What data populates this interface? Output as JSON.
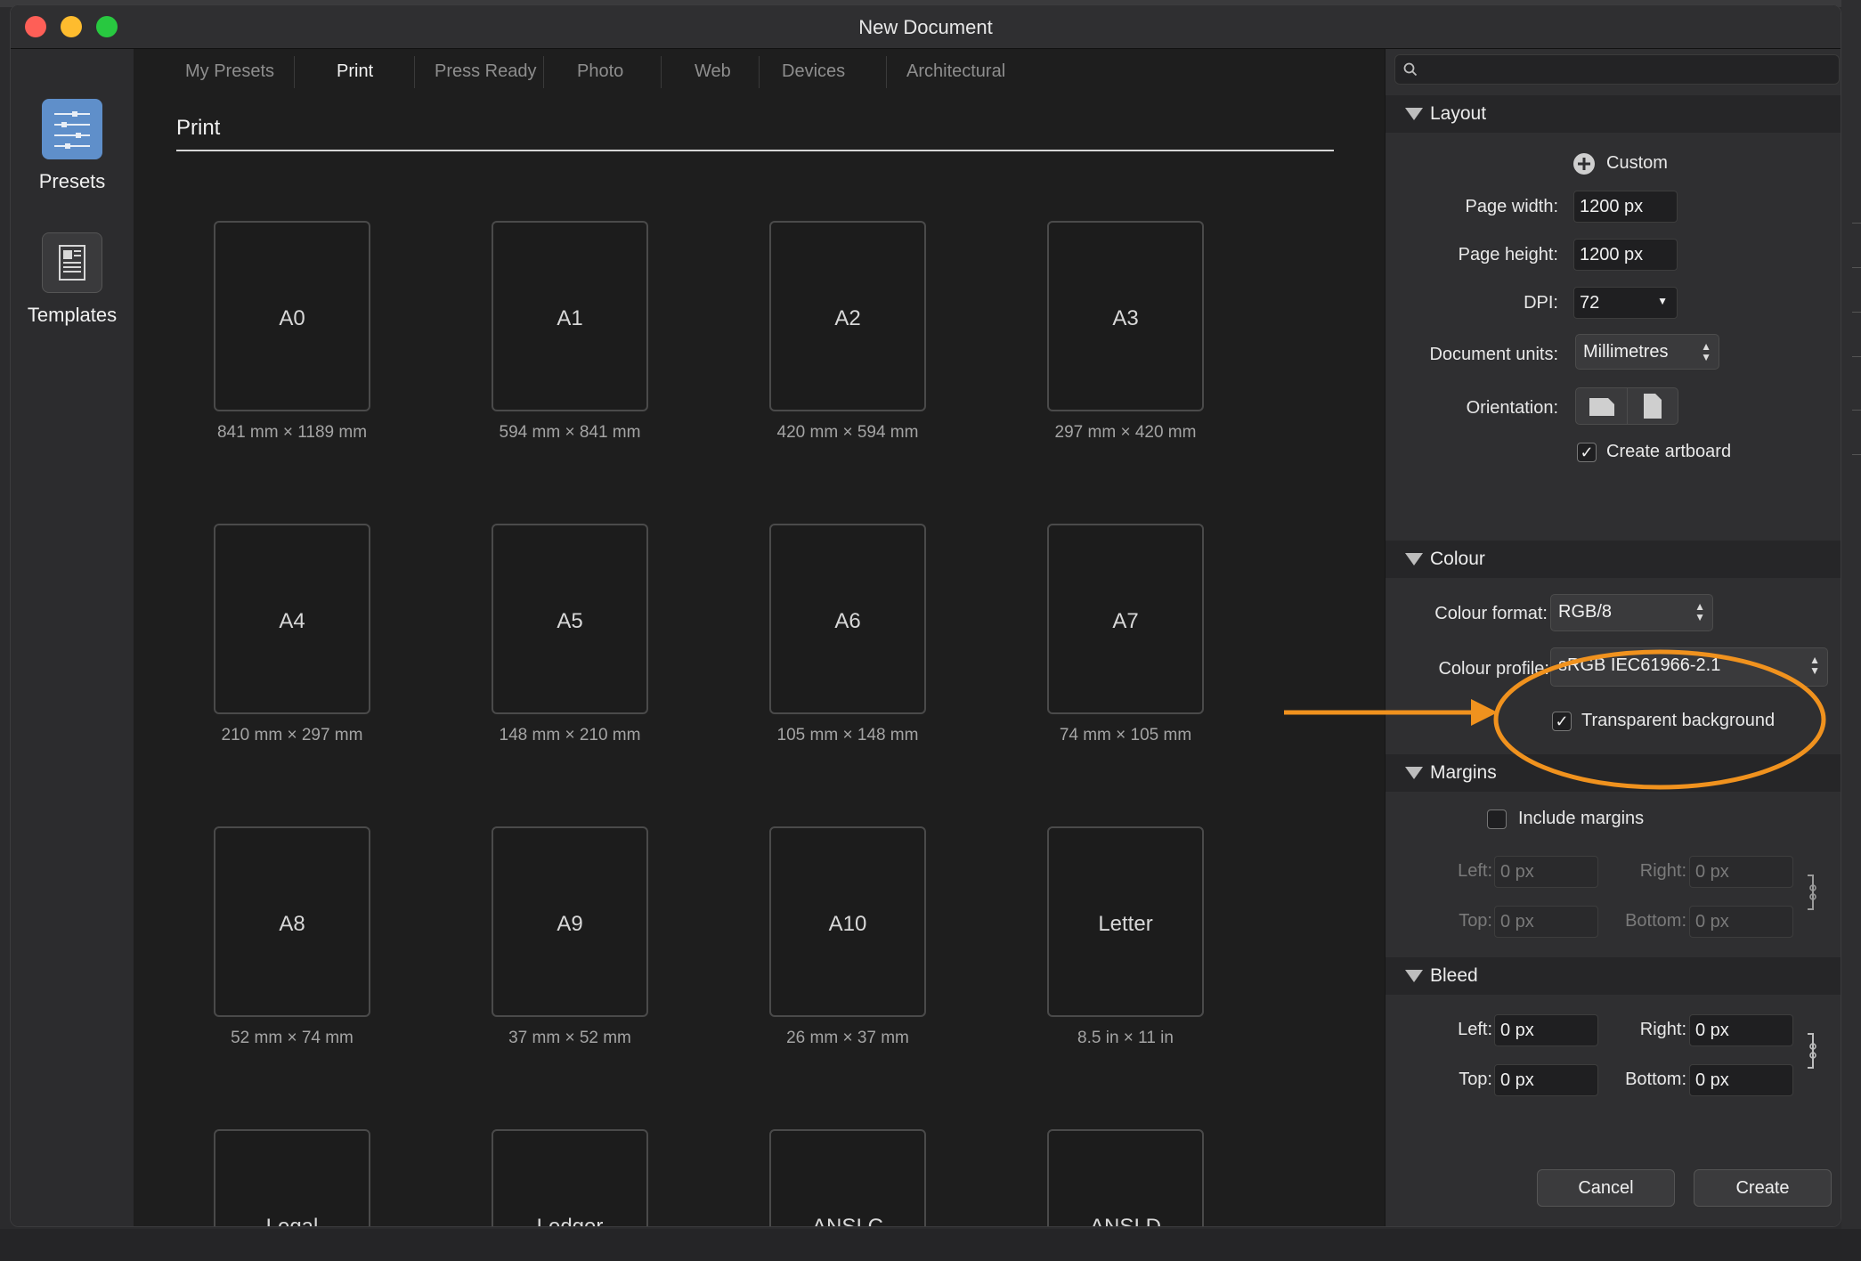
{
  "window": {
    "title": "New Document"
  },
  "sidebar": {
    "presets_label": "Presets",
    "templates_label": "Templates"
  },
  "tabs": [
    {
      "label": "My Presets"
    },
    {
      "label": "Print"
    },
    {
      "label": "Press Ready"
    },
    {
      "label": "Photo"
    },
    {
      "label": "Web"
    },
    {
      "label": "Devices"
    },
    {
      "label": "Architectural"
    }
  ],
  "section_title": "Print",
  "presets": [
    {
      "name": "A0",
      "dims": "841 mm × 1189 mm"
    },
    {
      "name": "A1",
      "dims": "594 mm × 841 mm"
    },
    {
      "name": "A2",
      "dims": "420 mm × 594 mm"
    },
    {
      "name": "A3",
      "dims": "297 mm × 420 mm"
    },
    {
      "name": "A4",
      "dims": "210 mm × 297 mm"
    },
    {
      "name": "A5",
      "dims": "148 mm × 210 mm"
    },
    {
      "name": "A6",
      "dims": "105 mm × 148 mm"
    },
    {
      "name": "A7",
      "dims": "74 mm × 105 mm"
    },
    {
      "name": "A8",
      "dims": "52 mm × 74 mm"
    },
    {
      "name": "A9",
      "dims": "37 mm × 52 mm"
    },
    {
      "name": "A10",
      "dims": "26 mm × 37 mm"
    },
    {
      "name": "Letter",
      "dims": "8.5 in × 11 in"
    },
    {
      "name": "Legal",
      "dims": ""
    },
    {
      "name": "Ledger",
      "dims": ""
    },
    {
      "name": "ANSI C",
      "dims": ""
    },
    {
      "name": "ANSI D",
      "dims": ""
    }
  ],
  "search": {
    "placeholder": ""
  },
  "layout": {
    "heading": "Layout",
    "custom_label": "Custom",
    "page_width_label": "Page width:",
    "page_width": "1200 px",
    "page_height_label": "Page height:",
    "page_height": "1200 px",
    "dpi_label": "DPI:",
    "dpi": "72",
    "units_label": "Document units:",
    "units": "Millimetres",
    "orientation_label": "Orientation:",
    "create_artboard_label": "Create artboard",
    "create_artboard_checked": true
  },
  "colour": {
    "heading": "Colour",
    "format_label": "Colour format:",
    "format": "RGB/8",
    "profile_label": "Colour profile:",
    "profile": "sRGB IEC61966-2.1",
    "transparent_label": "Transparent background",
    "transparent_checked": true
  },
  "margins": {
    "heading": "Margins",
    "include_label": "Include margins",
    "include_checked": false,
    "left_label": "Left:",
    "left": "0 px",
    "right_label": "Right:",
    "right": "0 px",
    "top_label": "Top:",
    "top": "0 px",
    "bottom_label": "Bottom:",
    "bottom": "0 px"
  },
  "bleed": {
    "heading": "Bleed",
    "left_label": "Left:",
    "left": "0 px",
    "right_label": "Right:",
    "right": "0 px",
    "top_label": "Top:",
    "top": "0 px",
    "bottom_label": "Bottom:",
    "bottom": "0 px"
  },
  "buttons": {
    "cancel": "Cancel",
    "create": "Create"
  },
  "colors": {
    "accent": "#f0921e",
    "presets_icon": "#5f8fca"
  }
}
